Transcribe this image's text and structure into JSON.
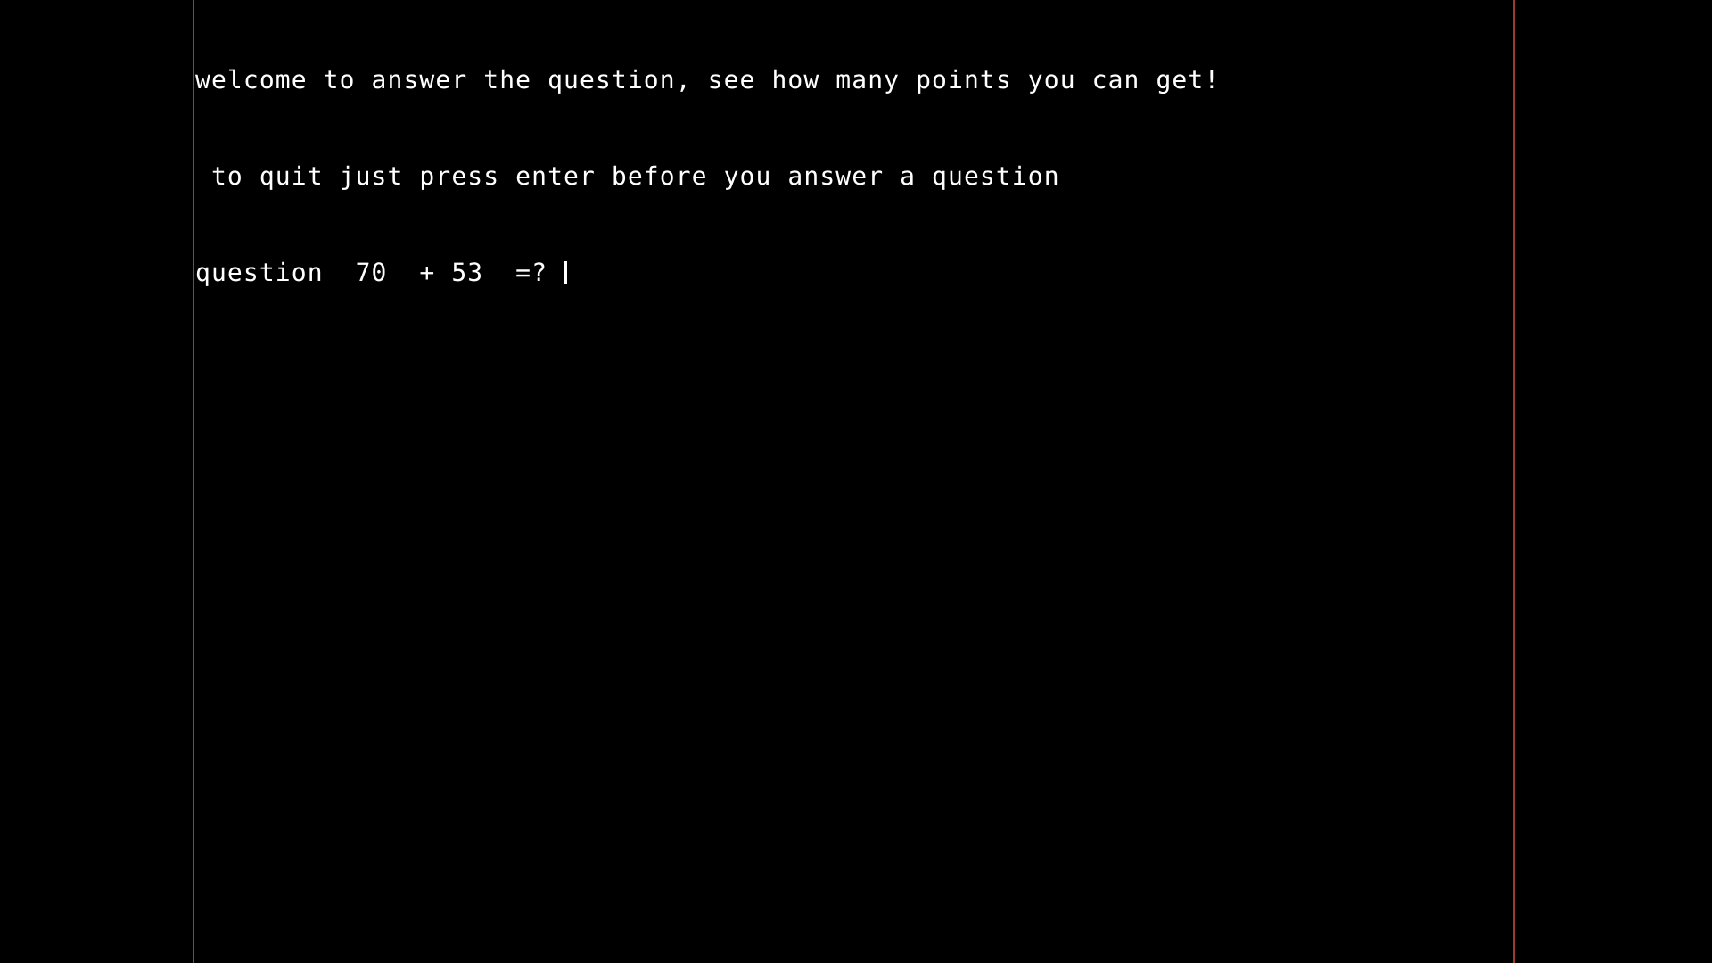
{
  "app": {
    "type": "terminal",
    "background_color": "#000000",
    "foreground_color": "#ffffff",
    "border_color": "#a03a2a"
  },
  "terminal": {
    "lines": [
      "welcome to answer the question, see how many points you can get!",
      " to quit just press enter before you answer a question",
      "question  70  + 53  =? "
    ],
    "line1": "welcome to answer the question, see how many points you can get!",
    "line2": " to quit just press enter before you answer a question",
    "line3": "question  70  + 53  =? ",
    "cursor_visible": true
  },
  "program": {
    "title_message": "welcome to answer the question, see how many points you can get!",
    "quit_instruction": " to quit just press enter before you answer a question",
    "prompt_label": "question",
    "operand_left": "70",
    "operator": "+",
    "operand_right": "53",
    "equals_prompt": "=?",
    "answer_input_value": ""
  }
}
